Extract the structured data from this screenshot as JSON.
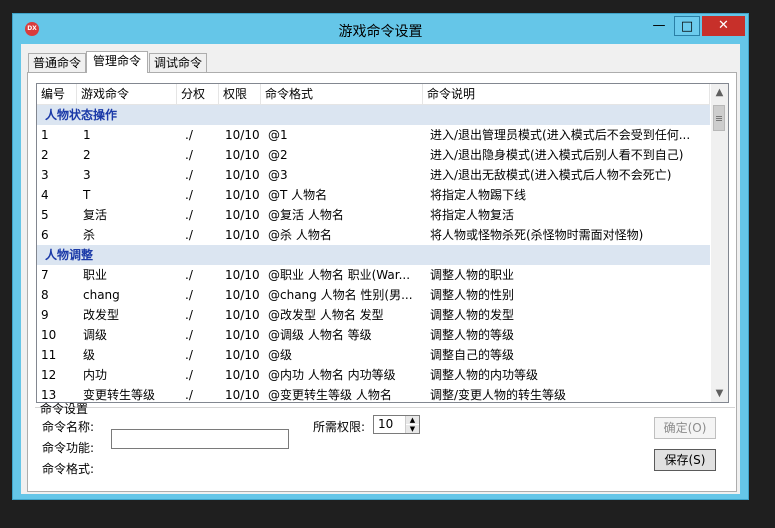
{
  "window": {
    "title": "游戏命令设置",
    "icon_text": "DX",
    "min_glyph": "—",
    "max_glyph": "□",
    "close_glyph": "✕"
  },
  "tabs": [
    "普通命令",
    "管理命令",
    "调试命令"
  ],
  "table": {
    "headers": [
      "编号",
      "游戏命令",
      "分权",
      "权限",
      "命令格式",
      "命令说明"
    ],
    "groups": [
      {
        "title": "人物状态操作",
        "rows": [
          [
            "1",
            "1",
            "./",
            "10/10",
            "@1",
            "进入/退出管理员模式(进入模式后不会受到任何..."
          ],
          [
            "2",
            "2",
            "./",
            "10/10",
            "@2",
            "进入/退出隐身模式(进入模式后别人看不到自己)"
          ],
          [
            "3",
            "3",
            "./",
            "10/10",
            "@3",
            "进入/退出无敌模式(进入模式后人物不会死亡)"
          ],
          [
            "4",
            "T",
            "./",
            "10/10",
            "@T 人物名",
            "将指定人物踢下线"
          ],
          [
            "5",
            "复活",
            "./",
            "10/10",
            "@复活 人物名",
            "将指定人物复活"
          ],
          [
            "6",
            "杀",
            "./",
            "10/10",
            "@杀 人物名",
            "将人物或怪物杀死(杀怪物时需面对怪物)"
          ]
        ]
      },
      {
        "title": "人物调整",
        "rows": [
          [
            "7",
            "职业",
            "./",
            "10/10",
            "@职业 人物名 职业(War...",
            "调整人物的职业"
          ],
          [
            "8",
            "chang",
            "./",
            "10/10",
            "@chang 人物名 性别(男...",
            "调整人物的性别"
          ],
          [
            "9",
            "改发型",
            "./",
            "10/10",
            "@改发型 人物名 发型",
            "调整人物的发型"
          ],
          [
            "10",
            "调级",
            "./",
            "10/10",
            "@调级 人物名 等级",
            "调整人物的等级"
          ],
          [
            "11",
            "级",
            "./",
            "10/10",
            "@级",
            "调整自己的等级"
          ],
          [
            "12",
            "内功",
            "./",
            "10/10",
            "@内功 人物名 内功等级",
            "调整人物的内功等级"
          ],
          [
            "13",
            "变更转生等级",
            "./",
            "10/10",
            "@变更转生等级 人物名",
            "调整/变更人物的转生等级"
          ]
        ]
      }
    ]
  },
  "settings": {
    "group_label": "命令设置",
    "name_label": "命令名称:",
    "name_value": "",
    "perm_label": "所需权限:",
    "perm_value": "10",
    "func_label": "命令功能:",
    "format_label": "命令格式:",
    "ok_label": "确定(O)",
    "save_label": "保存(S)"
  }
}
